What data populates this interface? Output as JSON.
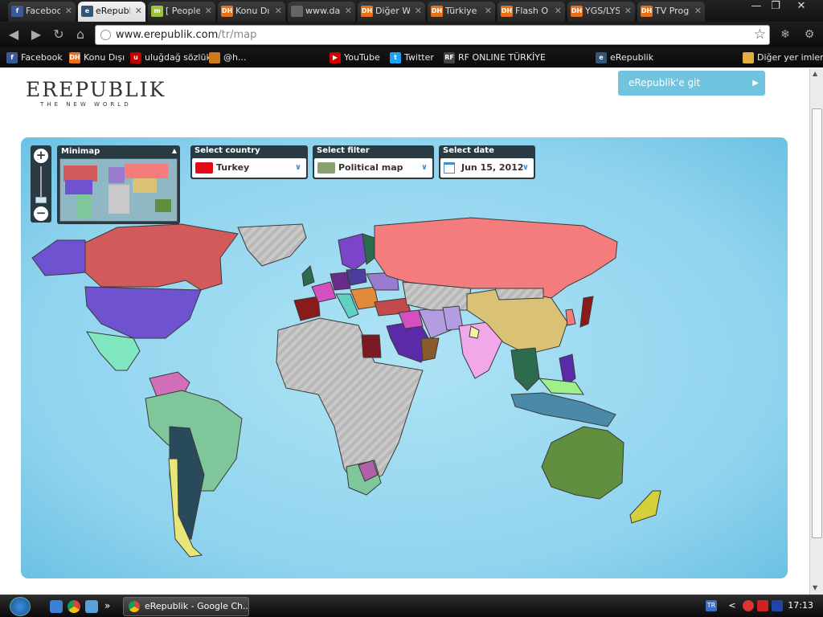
{
  "browser": {
    "tabs": [
      {
        "label": "Faceboo",
        "icon": "facebook-icon",
        "color": "#3b5998",
        "glyph": "f",
        "active": false
      },
      {
        "label": "eRepubl",
        "icon": "erepublik-icon",
        "color": "#335577",
        "glyph": "e",
        "active": true
      },
      {
        "label": "[ People",
        "icon": "m-icon",
        "color": "#9bc53d",
        "glyph": "m",
        "active": false
      },
      {
        "label": "Konu Dı",
        "icon": "dh-icon",
        "color": "#e8701a",
        "glyph": "DH",
        "active": false
      },
      {
        "label": "www.da",
        "icon": "loading-icon",
        "color": "#666666",
        "glyph": "",
        "active": false
      },
      {
        "label": "Diğer W",
        "icon": "dh-icon",
        "color": "#e8701a",
        "glyph": "DH",
        "active": false
      },
      {
        "label": "Türkiye",
        "icon": "dh-icon",
        "color": "#e8701a",
        "glyph": "DH",
        "active": false
      },
      {
        "label": "Flash O",
        "icon": "dh-icon",
        "color": "#e8701a",
        "glyph": "DH",
        "active": false
      },
      {
        "label": "YGS/LYS",
        "icon": "dh-icon",
        "color": "#e8701a",
        "glyph": "DH",
        "active": false
      },
      {
        "label": "TV Prog",
        "icon": "dh-icon",
        "color": "#e8701a",
        "glyph": "DH",
        "active": false
      }
    ],
    "url_host": "www.erepublik.com",
    "url_path": "/tr/map",
    "bookmarks": [
      {
        "label": "Facebook",
        "icon": "facebook-icon",
        "color": "#3b5998",
        "glyph": "f"
      },
      {
        "label": "Konu Dışı",
        "icon": "dh-icon",
        "color": "#e8701a",
        "glyph": "DH"
      },
      {
        "label": "uluğdağ sözlük",
        "icon": "uludag-icon",
        "color": "#c00000",
        "glyph": "u"
      },
      {
        "label": "@h...",
        "icon": "bookmark-icon",
        "color": "#d07a1a",
        "glyph": ""
      },
      {
        "label": "YouTube",
        "icon": "youtube-icon",
        "color": "#cc0000",
        "glyph": "▶"
      },
      {
        "label": "Twitter",
        "icon": "twitter-icon",
        "color": "#1da1f2",
        "glyph": "t"
      },
      {
        "label": "RF ONLINE TÜRKİYE",
        "icon": "rf-online-icon",
        "color": "#444444",
        "glyph": "RF"
      },
      {
        "label": "eRepublik",
        "icon": "erepublik-icon",
        "color": "#335577",
        "glyph": "e"
      }
    ],
    "other_bookmarks": "Diğer yer imleri"
  },
  "page": {
    "logo": "EREPUBLIK",
    "logo_tagline": "THE NEW WORLD",
    "cta_label": "eRepublik'e git"
  },
  "map": {
    "minimap_title": "Minimap",
    "select_country_label": "Select country",
    "select_country_value": "Turkey",
    "select_filter_label": "Select filter",
    "select_filter_value": "Political map",
    "select_date_label": "Select date",
    "select_date_value": "Jun 15, 2012"
  },
  "taskbar": {
    "task_label": "eRepublik - Google Ch...",
    "language": "TR",
    "clock": "17:13"
  }
}
